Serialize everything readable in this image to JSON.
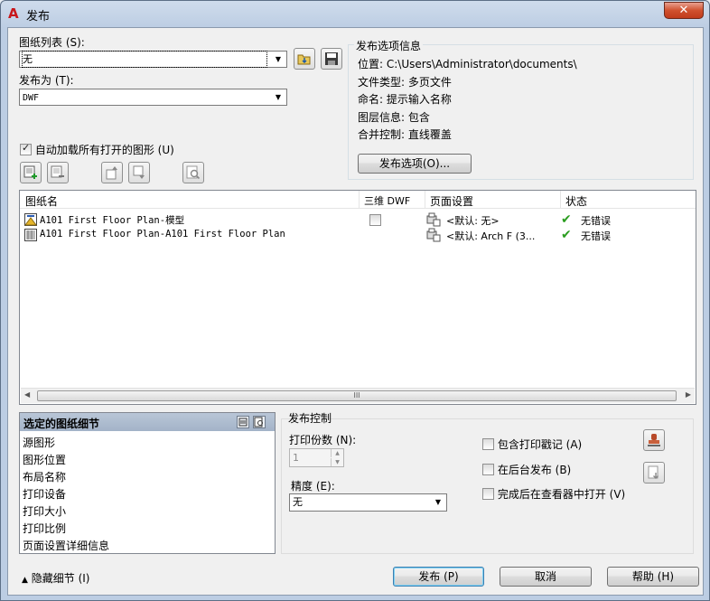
{
  "window": {
    "title": "发布",
    "close_label": "✕"
  },
  "sheet_list": {
    "label": "图纸列表 (S):",
    "value": "无"
  },
  "publish_to": {
    "label": "发布为 (T):",
    "value": "DWF"
  },
  "options_info": {
    "title": "发布选项信息",
    "location": "位置: C:\\Users\\Administrator\\documents\\",
    "file_type": "文件类型: 多页文件",
    "naming": "命名: 提示输入名称",
    "layer_info": "图层信息: 包含",
    "merge_control": "合并控制: 直线覆盖",
    "options_button": "发布选项(O)..."
  },
  "autoload": {
    "label": "自动加载所有打开的图形 (U)",
    "checked": true
  },
  "table": {
    "headers": [
      "图纸名",
      "三维 DWF",
      "页面设置",
      "状态"
    ],
    "rows": [
      {
        "name": "A101 First Floor Plan-模型",
        "page_setup": "<默认: 无>",
        "status": "无错误",
        "icon": "model-sheet-icon"
      },
      {
        "name": "A101 First Floor Plan-A101 First Floor Plan",
        "page_setup": "<默认: Arch F (3...",
        "status": "无错误",
        "icon": "layout-sheet-icon"
      }
    ],
    "scroll_grip": "III"
  },
  "details": {
    "title": "选定的图纸细节",
    "items": [
      "源图形",
      "图形位置",
      "布局名称",
      "打印设备",
      "打印大小",
      "打印比例",
      "页面设置详细信息"
    ]
  },
  "publish_control": {
    "title": "发布控制",
    "copies_label": "打印份数 (N):",
    "copies_value": "1",
    "precision_label": "精度 (E):",
    "precision_value": "无",
    "include_stamp": "包含打印戳记 (A)",
    "background_publish": "在后台发布 (B)",
    "open_viewer": "完成后在查看器中打开 (V)"
  },
  "footer": {
    "hide_details": "隐藏细节 (I)",
    "publish_button": "发布 (P)",
    "cancel_button": "取消",
    "help_button": "帮助 (H)"
  },
  "colors": {
    "status_ok": "#2a9d1f",
    "title_bar": "#bccde3",
    "app_icon": "#c8171b"
  }
}
